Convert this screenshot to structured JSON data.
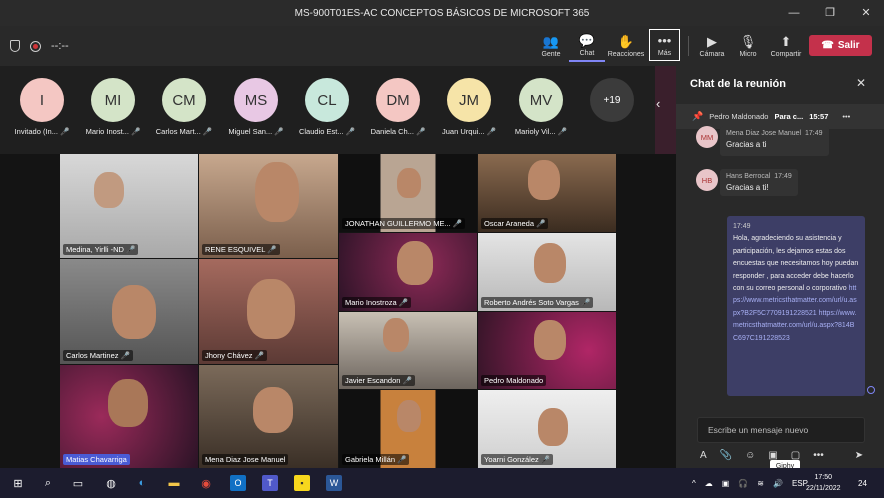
{
  "window": {
    "title": "MS-900T01ES-AC CONCEPTOS BÁSICOS DE MICROSOFT 365",
    "minimize": "—",
    "restore": "❐",
    "close": "✕"
  },
  "toolbar": {
    "timer": "--:--",
    "gente": "Gente",
    "chat": "Chat",
    "reacciones": "Reacciones",
    "mas": "Más",
    "camara": "Cámara",
    "microfono": "Micro",
    "compartir": "Compartir",
    "salir": "Salir"
  },
  "participants": [
    {
      "initials": "I",
      "name": "Invitado (In...",
      "color": "#f4c7c3"
    },
    {
      "initials": "MI",
      "name": "Mario Inost...",
      "color": "#d4e4c8"
    },
    {
      "initials": "CM",
      "name": "Carlos Mart...",
      "color": "#d4e4c8"
    },
    {
      "initials": "MS",
      "name": "Miguel San...",
      "color": "#e8c8e4"
    },
    {
      "initials": "CL",
      "name": "Claudio Est...",
      "color": "#c8e8dc"
    },
    {
      "initials": "DM",
      "name": "Daniela Ch...",
      "color": "#f4c7c3"
    },
    {
      "initials": "JM",
      "name": "Juan Urqui...",
      "color": "#f6e4a8"
    },
    {
      "initials": "MV",
      "name": "Marioly Vil...",
      "color": "#d4e4c8"
    }
  ],
  "more_count": "+19",
  "video_tiles": [
    {
      "name": "Medina, Yirlli -ND"
    },
    {
      "name": "RENE ESQUIVEL"
    },
    {
      "name": "JONATHAN GUILLERMO ME..."
    },
    {
      "name": "Oscar Araneda"
    },
    {
      "name": "Mario Inostroza"
    },
    {
      "name": "Roberto Andrés Soto Vargas"
    },
    {
      "name": "Carlos Martinez"
    },
    {
      "name": "Jhony Chávez"
    },
    {
      "name": "Javier Escandon"
    },
    {
      "name": "Pedro Maldonado"
    },
    {
      "name": "Matias Chavarriga"
    },
    {
      "name": "Mena Diaz Jose Manuel"
    },
    {
      "name": "Gabriela Millán"
    },
    {
      "name": "Yoarni González"
    }
  ],
  "chat": {
    "title": "Chat de la reunión",
    "pinned": {
      "name": "Pedro Maldonado",
      "preview": "Para c...",
      "time": "15:57"
    },
    "messages": [
      {
        "initials": "MM",
        "author": "Mena Diaz Jose Manuel",
        "time": "17:49",
        "text": "Gracias a ti"
      },
      {
        "initials": "HB",
        "author": "Hans Berrocal",
        "time": "17:49",
        "text": "Gracias a ti!"
      }
    ],
    "my_message": {
      "time": "17:49",
      "text": "Hola, agradeciendo su asistencia y participación, les dejamos estas dos encuestas que necesitamos hoy puedan responder , para acceder debe hacerlo con su correo personal o corporativo",
      "link1": "https://www.metricsthatmatter.com/url/u.aspx?B2F5C7709191228521",
      "link2": "https://www.metricsthatmatter.com/url/u.aspx?814BC697C191228523"
    },
    "compose_placeholder": "Escribe un mensaje nuevo",
    "tooltip": "Giphy"
  },
  "taskbar": {
    "lang": "ESP",
    "time": "17:50",
    "date": "22/11/2022",
    "notif": "24"
  }
}
